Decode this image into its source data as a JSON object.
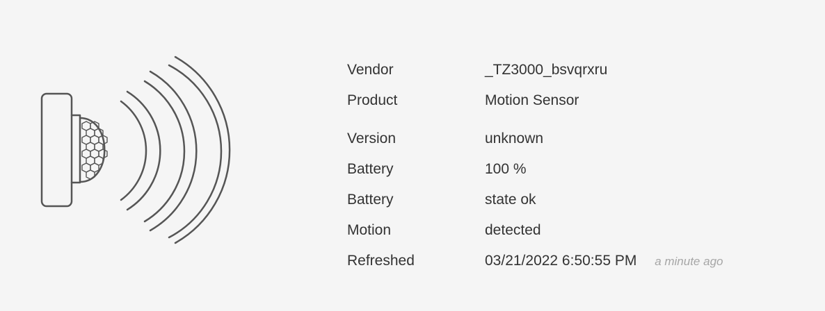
{
  "device_image": {
    "icon": "motion-sensor-icon",
    "stroke_color": "#555555"
  },
  "info": {
    "vendor": {
      "label": "Vendor",
      "value": "_TZ3000_bsvqrxru"
    },
    "product": {
      "label": "Product",
      "value": "Motion Sensor"
    },
    "version": {
      "label": "Version",
      "value": "unknown"
    },
    "battery_level": {
      "label": "Battery",
      "value": "100 %"
    },
    "battery_state": {
      "label": "Battery",
      "value": "state ok"
    },
    "motion": {
      "label": "Motion",
      "value": "detected"
    },
    "refreshed": {
      "label": "Refreshed",
      "value": "03/21/2022 6:50:55 PM",
      "relative": "a minute ago"
    }
  }
}
